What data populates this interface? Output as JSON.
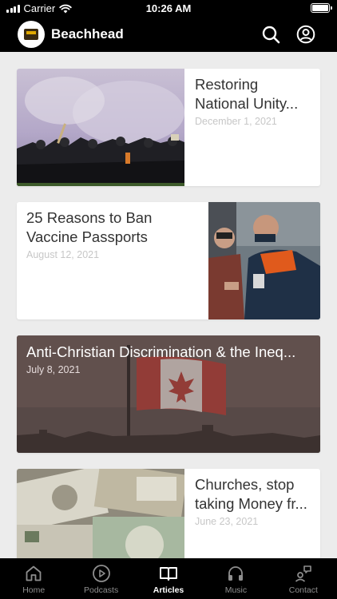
{
  "status_bar": {
    "carrier": "Carrier",
    "time": "10:26 AM",
    "wifi_icon": "wifi-icon",
    "battery_icon": "battery-icon"
  },
  "header": {
    "title": "Beachhead",
    "logo_icon": "beachhead-logo",
    "search_icon": "search-icon",
    "profile_icon": "profile-icon"
  },
  "articles": [
    {
      "title_line1": "Restoring",
      "title_line2": "National Unity...",
      "date": "December 1, 2021",
      "image": "protest-crowd-photo"
    },
    {
      "title_line1": "25 Reasons to Ban",
      "title_line2": "Vaccine Passports",
      "date": "August 12, 2021",
      "image": "phone-check-photo"
    },
    {
      "title": "Anti-Christian Discrimination & the Ineq...",
      "date": "July 8, 2021",
      "image": "canada-flag-photo"
    },
    {
      "title_line1": "Churches, stop",
      "title_line2": "taking Money fr...",
      "date": "June 23, 2021",
      "image": "cash-pile-photo"
    }
  ],
  "tabs": [
    {
      "label": "Home",
      "icon": "home-icon"
    },
    {
      "label": "Podcasts",
      "icon": "play-circle-icon"
    },
    {
      "label": "Articles",
      "icon": "book-open-icon",
      "active": true
    },
    {
      "label": "Music",
      "icon": "headphones-icon"
    },
    {
      "label": "Contact",
      "icon": "contact-icon"
    }
  ],
  "colors": {
    "background": "#000000",
    "content_bg": "#ececec",
    "active_tab": "#ffffff",
    "inactive_tab": "#8e8e8e",
    "date_text": "#c7c7c7"
  }
}
